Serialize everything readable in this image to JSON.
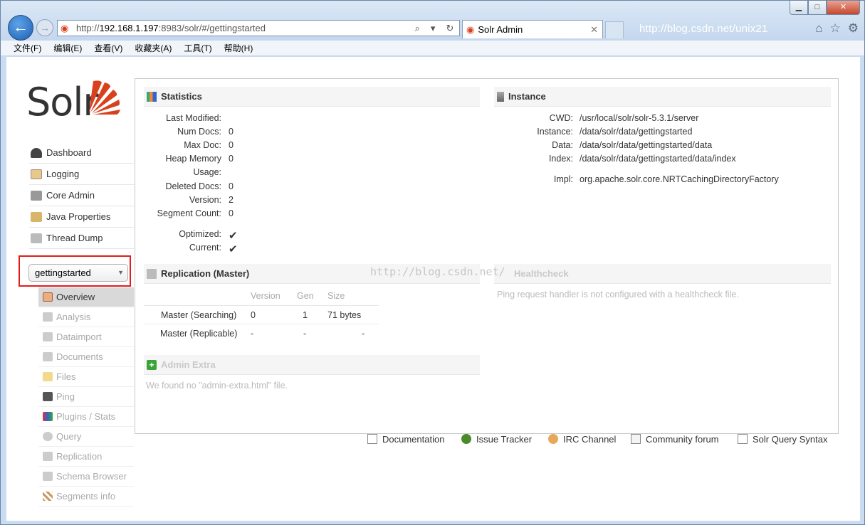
{
  "browser": {
    "url_prefix": "http://",
    "url_host": "192.168.1.197",
    "url_rest": ":8983/solr/#/gettingstarted",
    "tab_title": "Solr Admin",
    "watermark_top": "http://blog.csdn.net/unix21",
    "menu": [
      "文件(F)",
      "编辑(E)",
      "查看(V)",
      "收藏夹(A)",
      "工具(T)",
      "帮助(H)"
    ]
  },
  "logo_text": "Solr",
  "nav": [
    "Dashboard",
    "Logging",
    "Core Admin",
    "Java Properties",
    "Thread Dump"
  ],
  "core_selected": "gettingstarted",
  "subnav": [
    "Overview",
    "Analysis",
    "Dataimport",
    "Documents",
    "Files",
    "Ping",
    "Plugins / Stats",
    "Query",
    "Replication",
    "Schema Browser",
    "Segments info"
  ],
  "statistics": {
    "title": "Statistics",
    "rows": [
      {
        "k": "Last Modified:",
        "v": ""
      },
      {
        "k": "Num Docs:",
        "v": "0"
      },
      {
        "k": "Max Doc:",
        "v": "0"
      },
      {
        "k": "Heap Memory",
        "v": "0"
      },
      {
        "k": "Usage:",
        "v": ""
      },
      {
        "k": "Deleted Docs:",
        "v": "0"
      },
      {
        "k": "Version:",
        "v": "2"
      },
      {
        "k": "Segment Count:",
        "v": "0"
      },
      {
        "k": "Optimized:",
        "v": "✔"
      },
      {
        "k": "Current:",
        "v": "✔"
      }
    ]
  },
  "instance": {
    "title": "Instance",
    "rows": [
      {
        "k": "CWD:",
        "v": "/usr/local/solr/solr-5.3.1/server"
      },
      {
        "k": "Instance:",
        "v": "/data/solr/data/gettingstarted"
      },
      {
        "k": "Data:",
        "v": "/data/solr/data/gettingstarted/data"
      },
      {
        "k": "Index:",
        "v": "/data/solr/data/gettingstarted/data/index"
      },
      {
        "k": "Impl:",
        "v": "org.apache.solr.core.NRTCachingDirectoryFactory"
      }
    ]
  },
  "replication": {
    "title": "Replication (Master)",
    "headers": [
      "Version",
      "Gen",
      "Size"
    ],
    "rows": [
      {
        "name": "Master (Searching)",
        "version": "0",
        "gen": "1",
        "size": "71 bytes"
      },
      {
        "name": "Master (Replicable)",
        "version": "-",
        "gen": "-",
        "size": "-"
      }
    ]
  },
  "healthcheck": {
    "title": "Healthcheck",
    "message": "Ping request handler is not configured with a healthcheck file."
  },
  "admin_extra": {
    "title": "Admin Extra",
    "message": "We found no \"admin-extra.html\" file."
  },
  "watermark_center": "http://blog.csdn.net/",
  "footer": [
    "Documentation",
    "Issue Tracker",
    "IRC Channel",
    "Community forum",
    "Solr Query Syntax"
  ],
  "colors": {
    "solr_red": "#d9411e",
    "check_green": "#3aa43a",
    "highlight_box": "#e01c1c"
  }
}
